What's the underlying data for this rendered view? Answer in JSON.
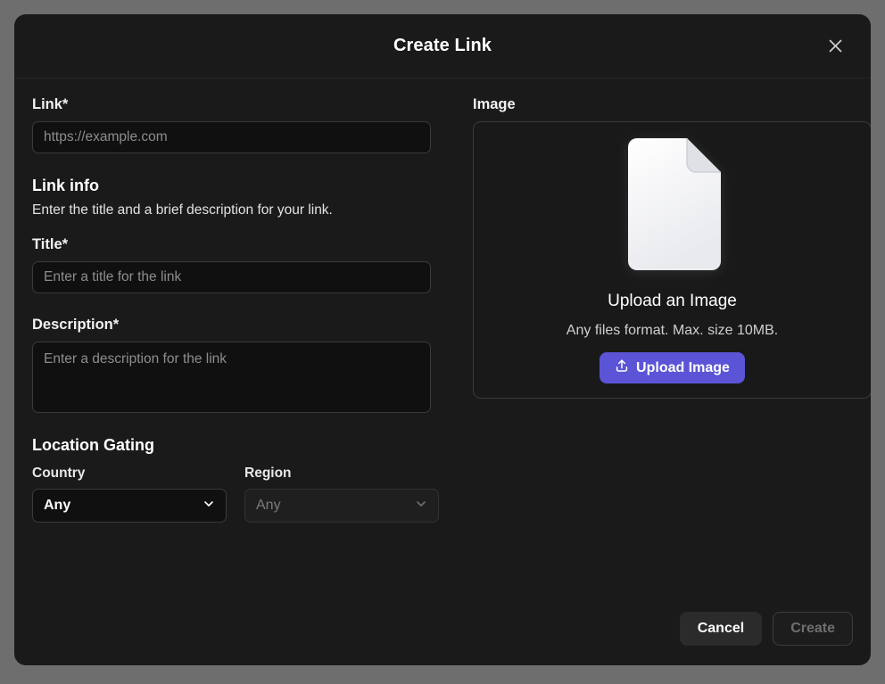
{
  "dialog": {
    "title": "Create Link",
    "close_icon": "close-icon"
  },
  "link_field": {
    "label": "Link*",
    "value": "",
    "placeholder": "https://example.com"
  },
  "link_info": {
    "heading": "Link info",
    "description": "Enter the title and a brief description for your link."
  },
  "title_field": {
    "label": "Title*",
    "value": "",
    "placeholder": "Enter a title for the link"
  },
  "description_field": {
    "label": "Description*",
    "value": "",
    "placeholder": "Enter a description for the link"
  },
  "location_gating": {
    "heading": "Location Gating",
    "country": {
      "label": "Country",
      "selected": "Any",
      "chevron_icon": "chevron-down-icon"
    },
    "region": {
      "label": "Region",
      "selected": "Any",
      "chevron_icon": "chevron-down-icon"
    }
  },
  "image": {
    "label": "Image",
    "dropzone_icon": "file-document-icon",
    "dropzone_title": "Upload an Image",
    "dropzone_hint": "Any files format. Max. size 10MB.",
    "upload_button_label": "Upload Image",
    "upload_button_icon": "upload-icon"
  },
  "footer": {
    "cancel_label": "Cancel",
    "create_label": "Create"
  },
  "colors": {
    "page_background": "#6e6e6e",
    "modal_background": "#1a1a1a",
    "input_background": "#101010",
    "border": "#3a3a3a",
    "accent_purple": "#5b54d6",
    "text_primary": "#ffffff",
    "text_muted": "#8d8d8d",
    "disabled_text": "#6f6f6f"
  }
}
